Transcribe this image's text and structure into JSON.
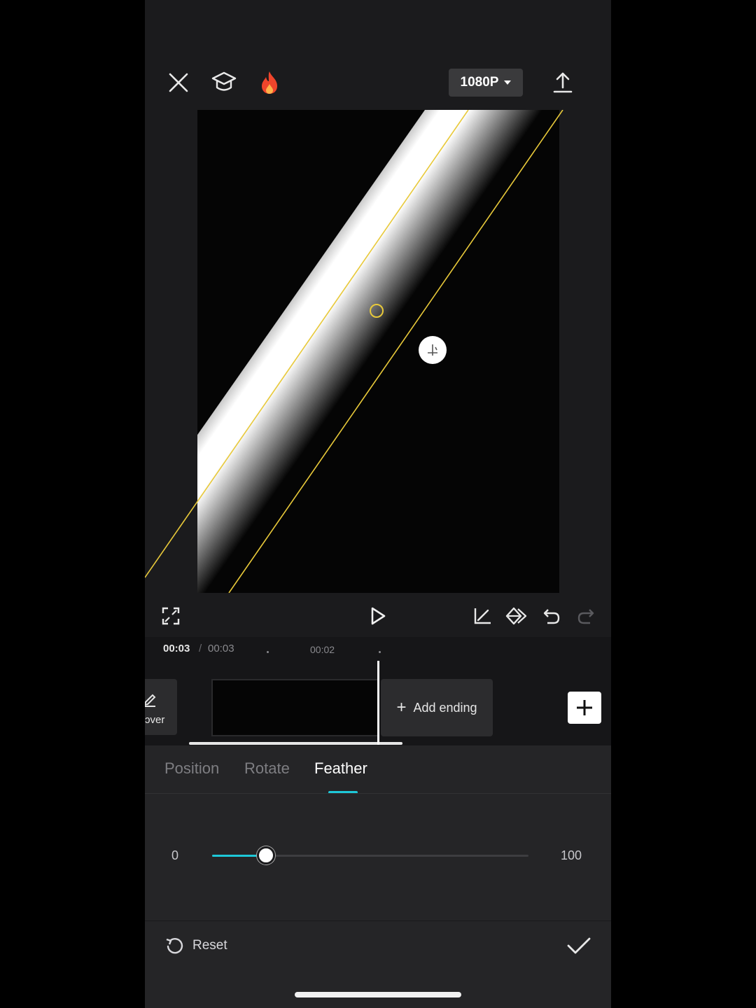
{
  "header": {
    "resolution_label": "1080P",
    "icons": [
      "close-icon",
      "tutorial-cap-icon",
      "fire-icon",
      "chevron-down-icon",
      "export-icon"
    ]
  },
  "toolbar": {
    "icons": [
      "fullscreen-icon",
      "play-icon",
      "keyframe-graph-icon",
      "keyframe-icon",
      "undo-icon",
      "redo-icon"
    ]
  },
  "timeline": {
    "current_time": "00:03",
    "separator": "/",
    "total_time": "00:03",
    "tick_label": "00:02",
    "cover_label": "ɔver",
    "add_ending_label": "Add ending"
  },
  "mask_panel": {
    "tabs": [
      {
        "label": "Position",
        "active": false
      },
      {
        "label": "Rotate",
        "active": false
      },
      {
        "label": "Feather",
        "active": true
      }
    ],
    "slider": {
      "min_label": "0",
      "max_label": "100",
      "value": 17
    },
    "reset_label": "Reset"
  },
  "colors": {
    "accent": "#1ec8d8",
    "mask_line": "#e8c93a",
    "background": "#1b1b1d",
    "panel": "#252527"
  }
}
